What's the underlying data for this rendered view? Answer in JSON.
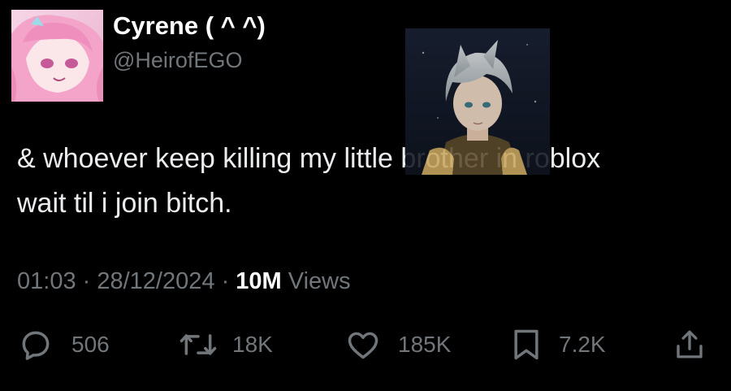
{
  "user": {
    "display_name": "Cyrene ( ^ ^)",
    "handle": "@HeirofEGO"
  },
  "tweet": {
    "text_line1": "& whoever keep killing my little brother in roblox",
    "text_line2": "wait til i join bitch."
  },
  "meta": {
    "time": "01:03",
    "sep1": " · ",
    "date": "28/12/2024",
    "sep2": " · ",
    "views_count": "10M",
    "views_label": " Views"
  },
  "actions": {
    "replies": "506",
    "reposts": "18K",
    "likes": "185K",
    "bookmarks": "7.2K"
  },
  "icons": {
    "reply": "reply-icon",
    "repost": "repost-icon",
    "like": "heart-icon",
    "bookmark": "bookmark-icon",
    "share": "share-icon"
  },
  "colors": {
    "background": "#000000",
    "primary_text": "#e7e9ea",
    "secondary_text": "#71767b"
  }
}
